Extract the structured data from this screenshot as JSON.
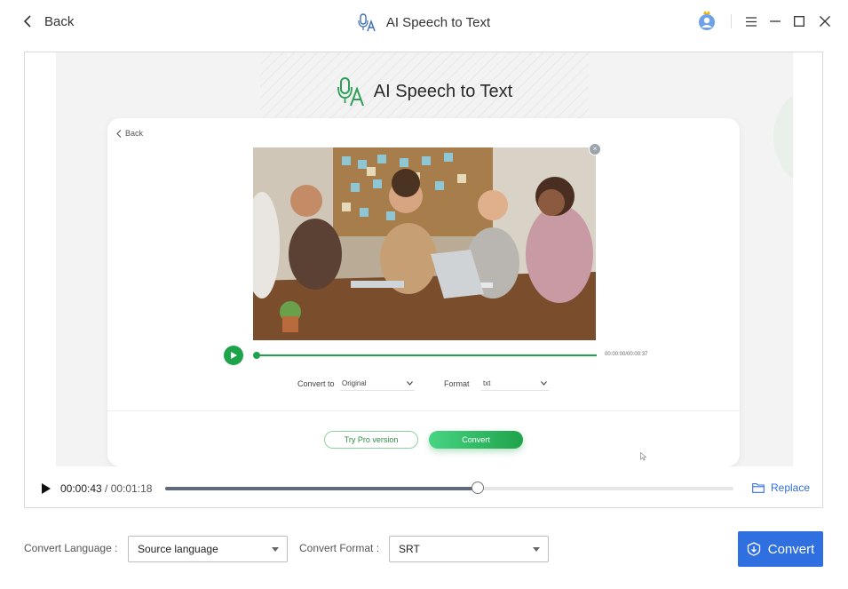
{
  "header": {
    "back_label": "Back",
    "title": "AI Speech to Text"
  },
  "preview": {
    "inner_title": "AI Speech to Text",
    "inner_back": "Back",
    "inner_time": "00:00:00/00:00:37",
    "convert_to_label": "Convert to",
    "convert_to_value": "Original",
    "format_label": "Format",
    "format_value": "txt",
    "try_pro": "Try Pro version",
    "convert_inner": "Convert"
  },
  "player": {
    "current_time": "00:00:43",
    "separator": " / ",
    "total_time": "00:01:18",
    "progress_fraction": 0.55,
    "replace_label": "Replace"
  },
  "bottom": {
    "language_label": "Convert Language :",
    "language_value": "Source language",
    "format_label": "Convert Format :",
    "format_value": "SRT",
    "convert_label": "Convert"
  },
  "colors": {
    "accent": "#2f6fe0",
    "green": "#1fa34a"
  }
}
